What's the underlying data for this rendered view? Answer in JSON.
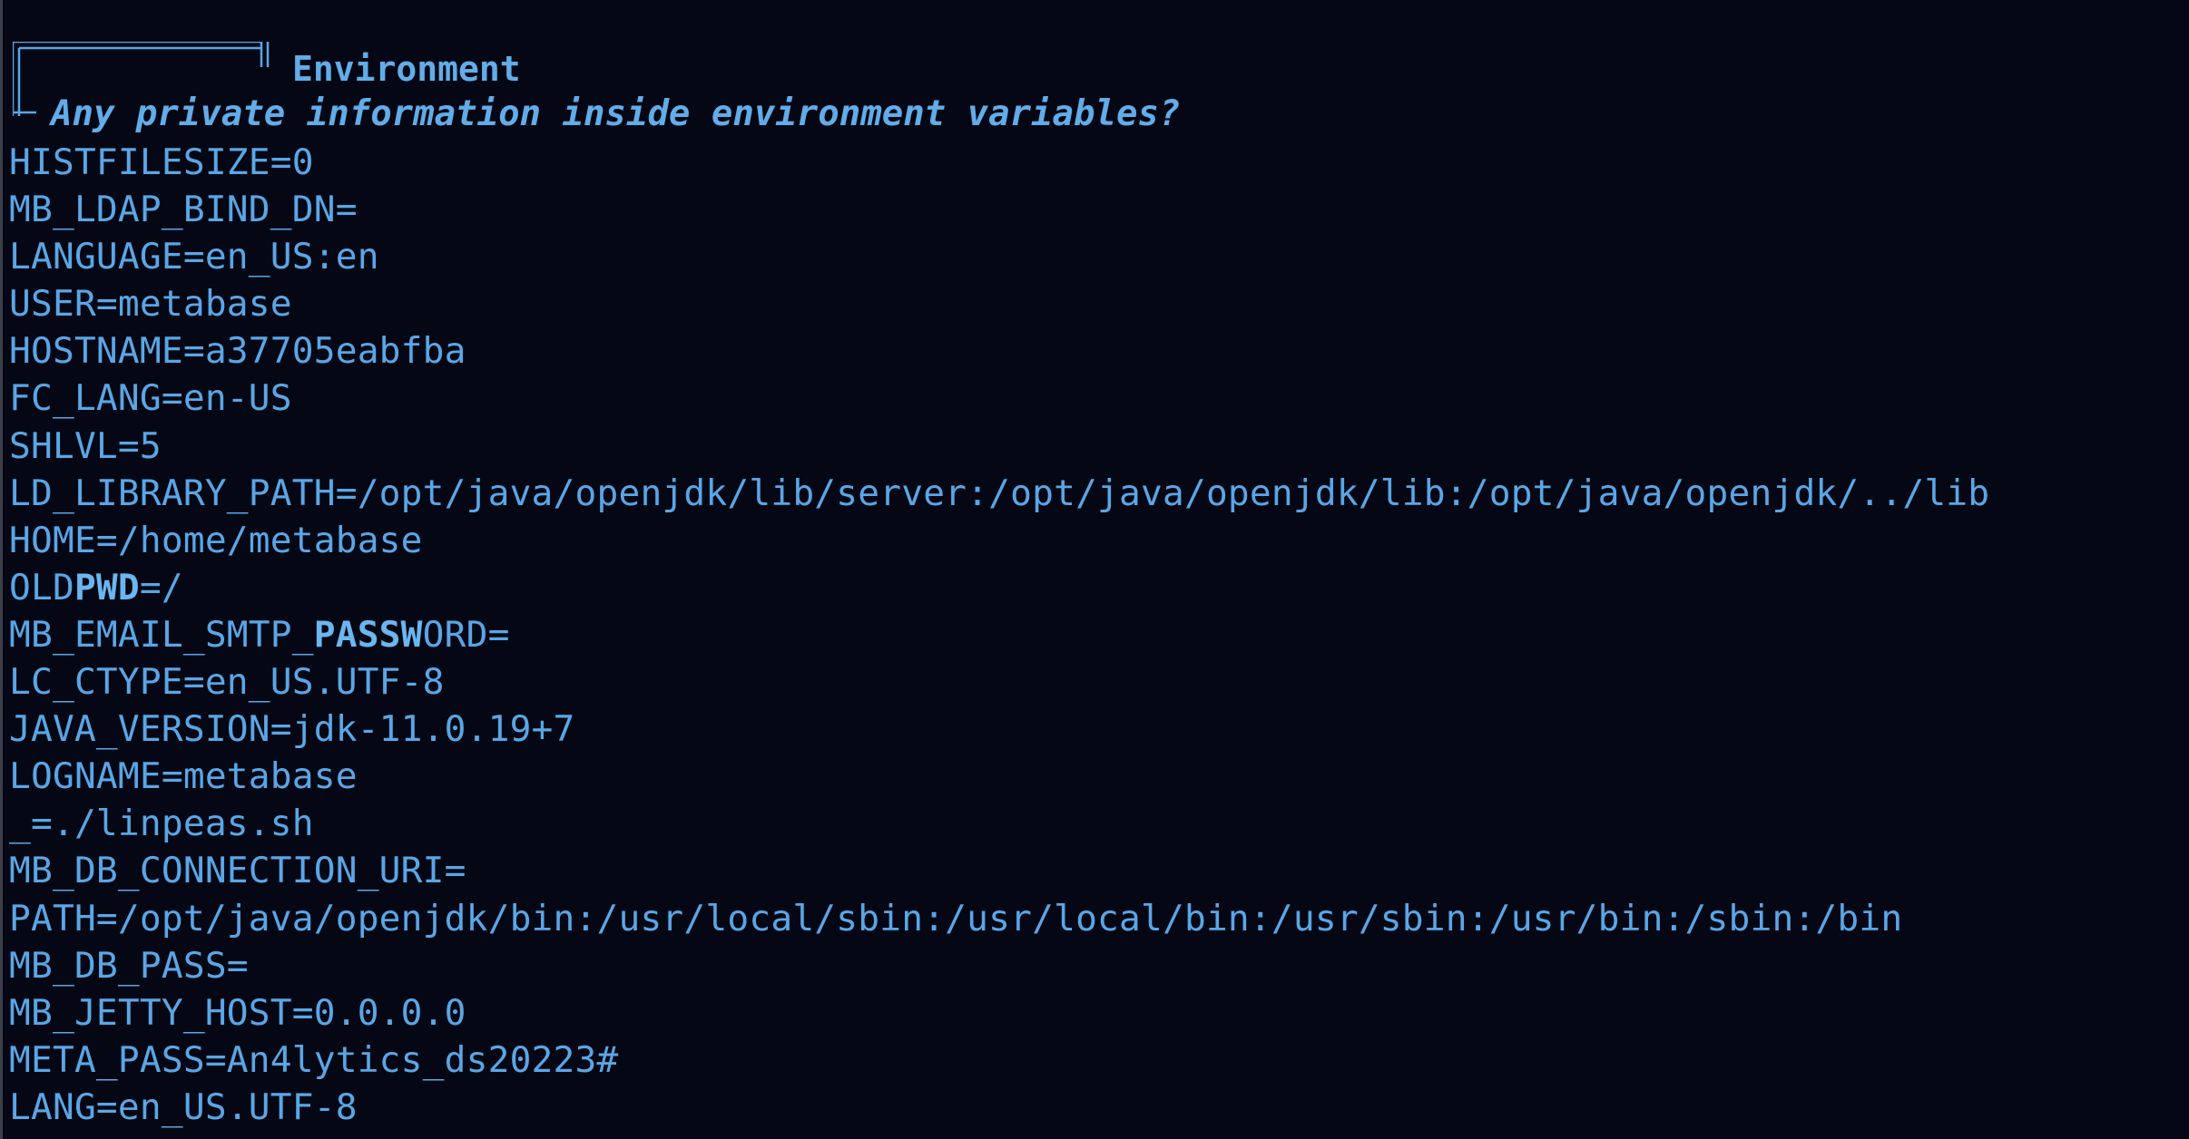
{
  "section": {
    "title": "Environment",
    "subtitle": "Any private information inside environment variables?"
  },
  "env_lines": [
    "HISTFILESIZE=0",
    "MB_LDAP_BIND_DN=",
    "LANGUAGE=en_US:en",
    "USER=metabase",
    "HOSTNAME=a37705eabfba",
    "FC_LANG=en-US",
    "SHLVL=5",
    "LD_LIBRARY_PATH=/opt/java/openjdk/lib/server:/opt/java/openjdk/lib:/opt/java/openjdk/../lib",
    "HOME=/home/metabase",
    "OLDPWD=/",
    "MB_EMAIL_SMTP_PASSWORD=",
    "LC_CTYPE=en_US.UTF-8",
    "JAVA_VERSION=jdk-11.0.19+7",
    "LOGNAME=metabase",
    "_=./linpeas.sh",
    "MB_DB_CONNECTION_URI=",
    "PATH=/opt/java/openjdk/bin:/usr/local/sbin:/usr/local/bin:/usr/sbin:/usr/bin:/sbin:/bin",
    "MB_DB_PASS=",
    "MB_JETTY_HOST=0.0.0.0",
    "META_PASS=An4lytics_ds20223#",
    "LANG=en_US.UTF-8"
  ],
  "highlights": {
    "9": [
      "OLD",
      "PWD",
      "=/"
    ],
    "10": [
      "MB_EMAIL_SMTP_",
      "PASSW",
      "ORD="
    ]
  },
  "colors": {
    "background": "#050814",
    "text": "#5aa6e6",
    "header": "#62ace8",
    "highlight": "#6cb6f0"
  }
}
